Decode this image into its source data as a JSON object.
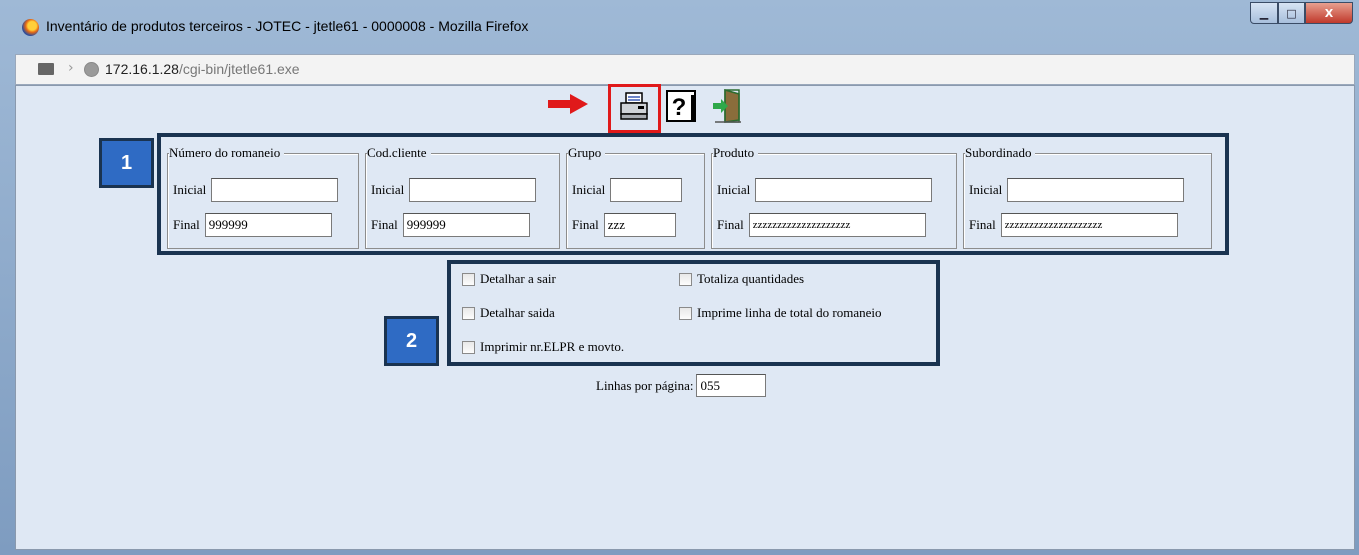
{
  "window": {
    "title": "Inventário de produtos terceiros - JOTEC - jtetle61 - 0000008 - Mozilla Firefox",
    "minimize_label": "▁",
    "maximize_label": "□",
    "close_label": "X"
  },
  "address": {
    "host": "172.16.1.28",
    "path": "/cgi-bin/jtetle61.exe"
  },
  "toolbar": {
    "items": [
      "printer-icon",
      "help-icon",
      "exit-icon"
    ],
    "highlight_color": "#e0191a",
    "arrow_color": "#e0191a"
  },
  "filters": [
    {
      "title": "Número do romaneio",
      "inicial_label": "Inicial",
      "final_label": "Final",
      "inicial_value": "",
      "final_value": "999999"
    },
    {
      "title": "Cod.cliente",
      "inicial_label": "Inicial",
      "final_label": "Final",
      "inicial_value": "",
      "final_value": "999999"
    },
    {
      "title": "Grupo",
      "inicial_label": "Inicial",
      "final_label": "Final",
      "inicial_value": "",
      "final_value": "zzz"
    },
    {
      "title": "Produto",
      "inicial_label": "Inicial",
      "final_label": "Final",
      "inicial_value": "",
      "final_value": "zzzzzzzzzzzzzzzzzzzz"
    },
    {
      "title": "Subordinado",
      "inicial_label": "Inicial",
      "final_label": "Final",
      "inicial_value": "",
      "final_value": "zzzzzzzzzzzzzzzzzzzz"
    }
  ],
  "options": {
    "detalhar_a_sair": "Detalhar a sair",
    "totaliza_quantidades": "Totaliza quantidades",
    "detalhar_saida": "Detalhar saida",
    "imprime_linha_total": "Imprime linha de total do romaneio",
    "imprimir_nr_elpr": "Imprimir nr.ELPR e movto."
  },
  "linhas": {
    "label": "Linhas por página:",
    "value": "055"
  },
  "badges": {
    "one": "1",
    "two": "2",
    "fill_color": "#2f6bc4",
    "border_color": "#1a3350"
  }
}
